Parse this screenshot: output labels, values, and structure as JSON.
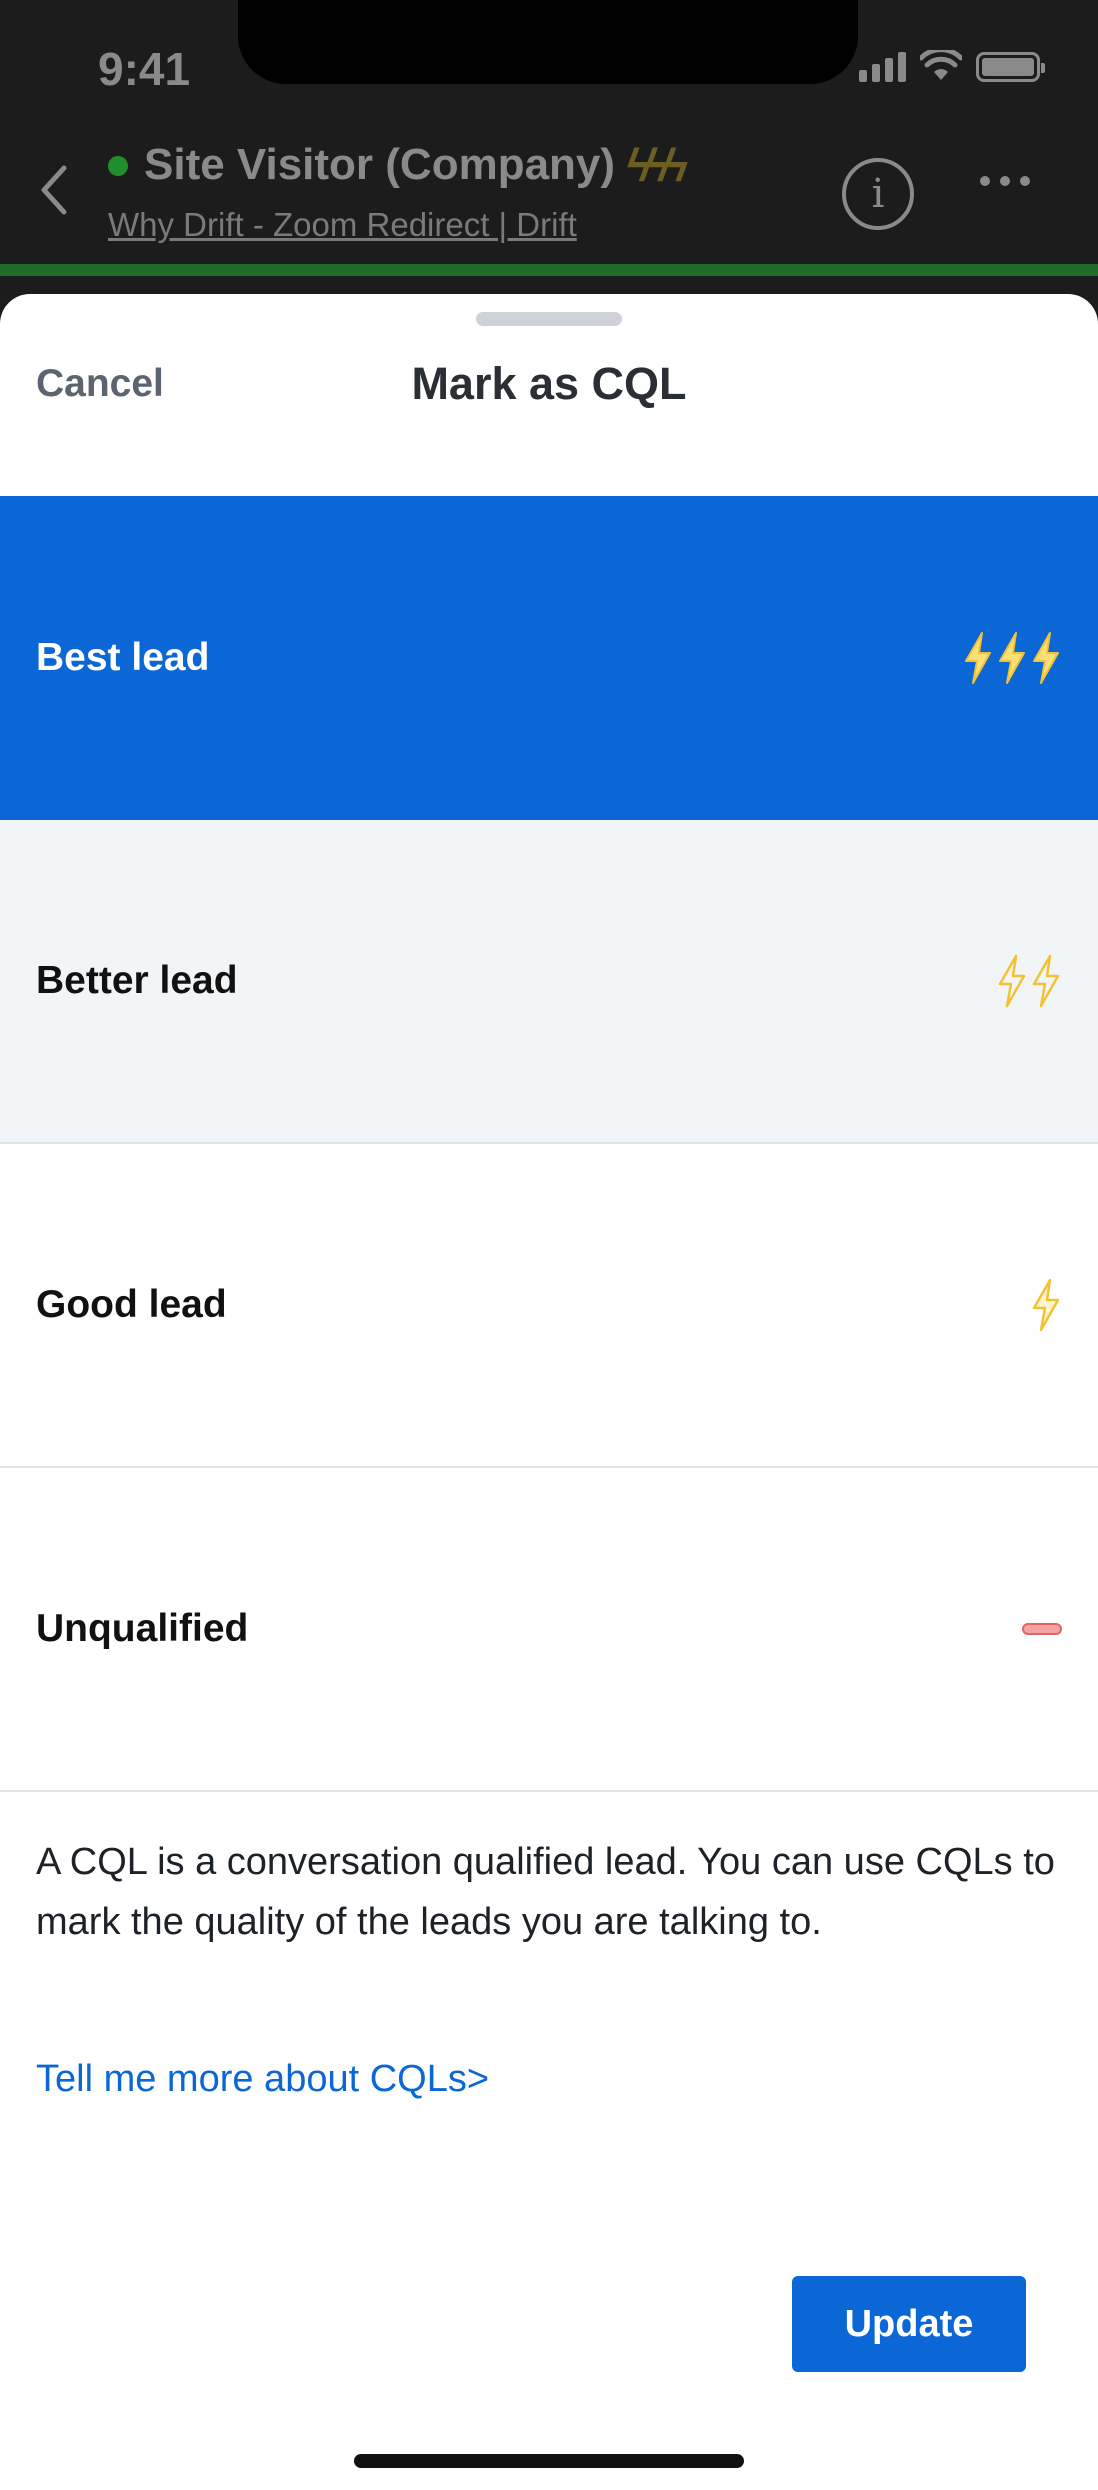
{
  "status_bar": {
    "time": "9:41"
  },
  "nav": {
    "title": "Site Visitor (Company)",
    "title_bolts": "ϟϟϟ",
    "subtitle": "Why Drift - Zoom Redirect | Drift",
    "info_glyph": "i"
  },
  "sheet": {
    "cancel_label": "Cancel",
    "title": "Mark as CQL",
    "options": [
      {
        "label": "Best lead",
        "bolts": 3,
        "state": "selected"
      },
      {
        "label": "Better lead",
        "bolts": 2,
        "state": "highlighted"
      },
      {
        "label": "Good lead",
        "bolts": 1,
        "state": "default"
      },
      {
        "label": "Unqualified",
        "bolts": 0,
        "state": "default"
      }
    ],
    "description": "A CQL is a conversation qualified lead. You can use CQLs to mark the quality of the leads you are talking to.",
    "more_link": "Tell me more about CQLs>",
    "update_label": "Update"
  },
  "colors": {
    "accent": "#0b67d6",
    "bolt_fill": "#fbe07a",
    "bolt_stroke": "#f2c233",
    "unqualified": "#e06666"
  }
}
